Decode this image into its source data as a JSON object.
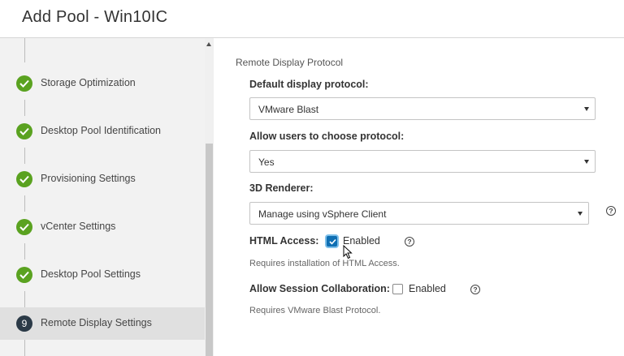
{
  "window": {
    "title": "Add Pool - Win10IC"
  },
  "sidebar": {
    "steps": [
      {
        "label": "Storage Optimization",
        "status": "done"
      },
      {
        "label": "Desktop Pool Identification",
        "status": "done"
      },
      {
        "label": "Provisioning Settings",
        "status": "done"
      },
      {
        "label": "vCenter Settings",
        "status": "done"
      },
      {
        "label": "Desktop Pool Settings",
        "status": "done"
      },
      {
        "label": "Remote Display Settings",
        "status": "active",
        "number": "9"
      }
    ]
  },
  "content": {
    "section_title": "Remote Display Protocol",
    "default_protocol": {
      "label": "Default display protocol:",
      "value": "VMware Blast"
    },
    "allow_choose": {
      "label": "Allow users to choose protocol:",
      "value": "Yes"
    },
    "renderer": {
      "label": "3D Renderer:",
      "value": "Manage using vSphere Client"
    },
    "html_access": {
      "label": "HTML Access:",
      "checkbox_label": "Enabled",
      "checked": true,
      "hint": "Requires installation of HTML Access."
    },
    "session_collab": {
      "label": "Allow Session Collaboration:",
      "checkbox_label": "Enabled",
      "checked": false,
      "hint": "Requires VMware Blast Protocol."
    },
    "help_glyph": "?"
  },
  "colors": {
    "step_done": "#5aa220",
    "step_active": "#2b3a47",
    "checkbox_checked": "#0f6fb3"
  }
}
